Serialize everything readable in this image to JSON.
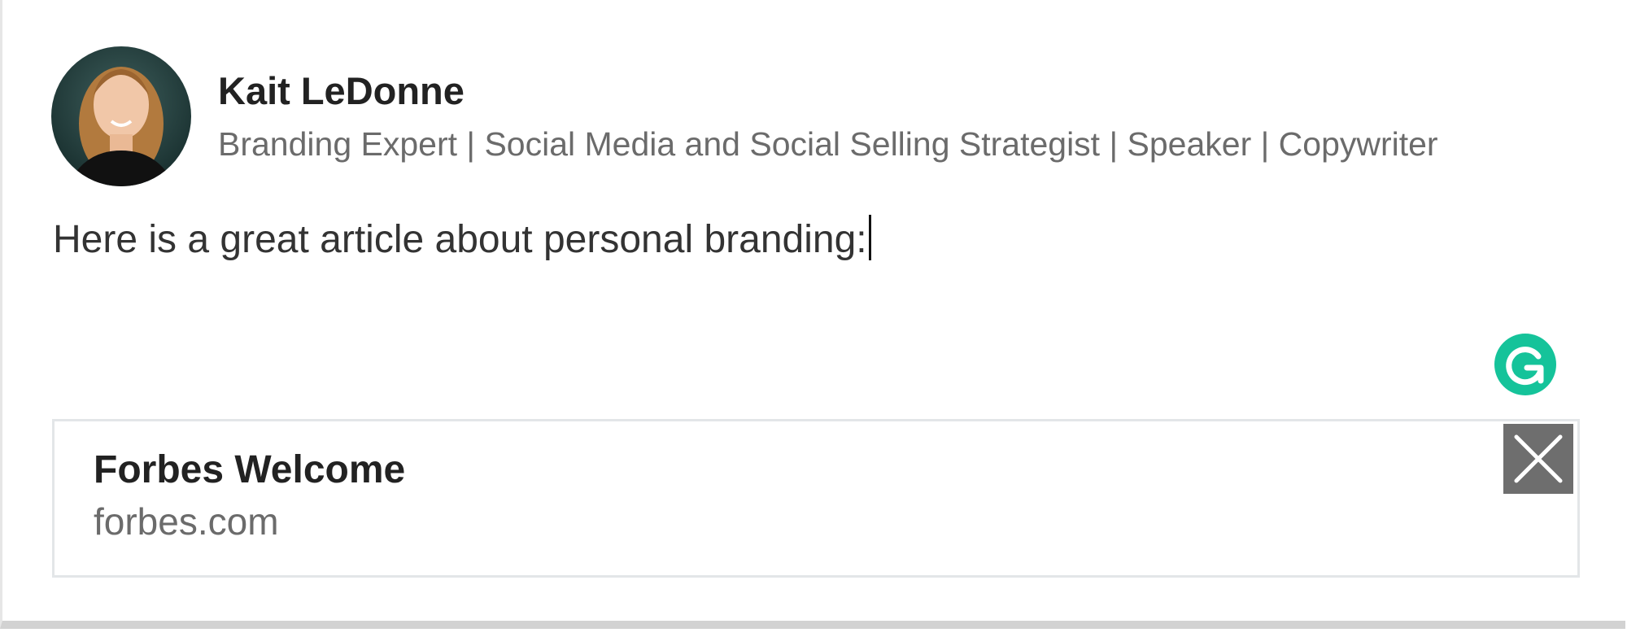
{
  "author": {
    "name": "Kait LeDonne",
    "headline": "Branding Expert | Social Media and Social Selling Strategist | Speaker | Copywriter",
    "avatar_icon": "profile-photo"
  },
  "post": {
    "text": "Here is a great article about personal branding:"
  },
  "grammarly": {
    "icon": "grammarly-icon",
    "color": "#15c39a"
  },
  "link_preview": {
    "title": "Forbes Welcome",
    "domain": "forbes.com",
    "close_icon": "close-icon"
  }
}
